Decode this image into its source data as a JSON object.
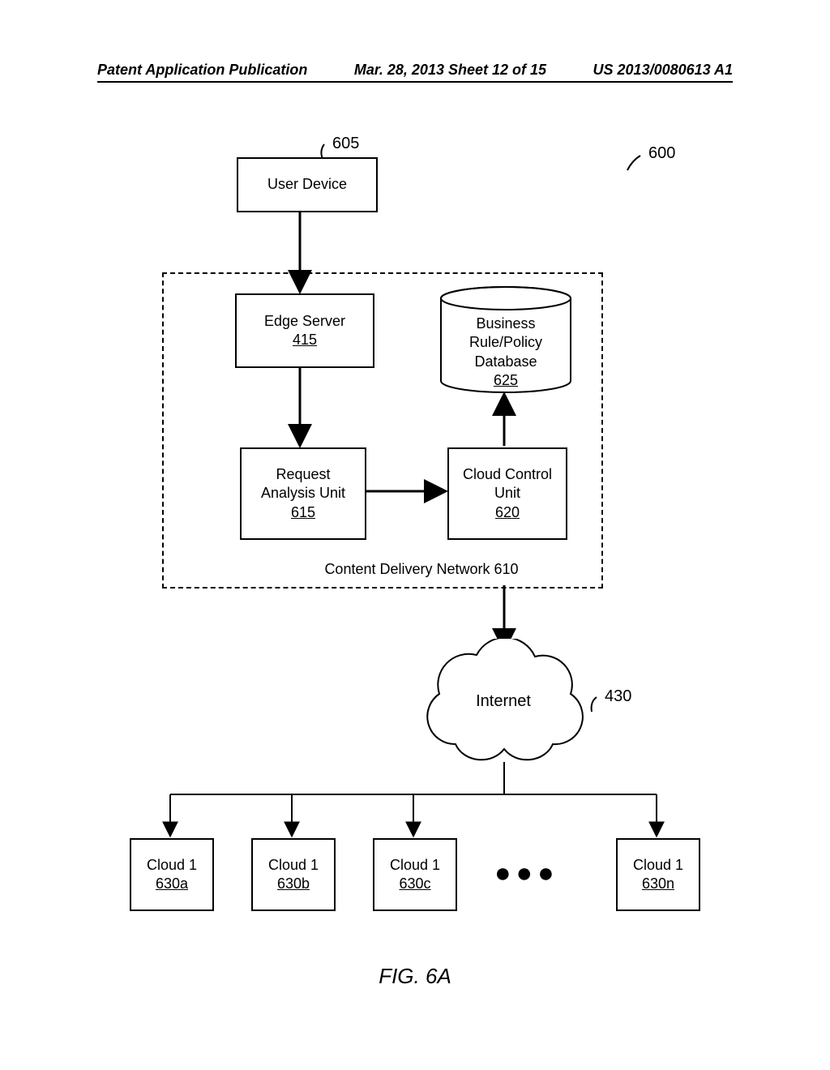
{
  "header": {
    "left": "Patent Application Publication",
    "center": "Mar. 28, 2013  Sheet 12 of 15",
    "right": "US 2013/0080613 A1"
  },
  "figure_label": "FIG. 6A",
  "callouts": {
    "system": "600",
    "user_device": "605",
    "internet": "430"
  },
  "nodes": {
    "user_device": {
      "label": "User Device"
    },
    "edge_server": {
      "label": "Edge Server",
      "ref": "415"
    },
    "request_analysis": {
      "label1": "Request",
      "label2": "Analysis Unit",
      "ref": "615"
    },
    "cloud_control": {
      "label1": "Cloud Control",
      "label2": "Unit",
      "ref": "620"
    },
    "db": {
      "label1": "Business",
      "label2": "Rule/Policy",
      "label3": "Database",
      "ref": "625"
    },
    "cdn_label": "Content Delivery Network 610",
    "internet": "Internet",
    "clouds": [
      {
        "label": "Cloud 1",
        "ref": "630a"
      },
      {
        "label": "Cloud 1",
        "ref": "630b"
      },
      {
        "label": "Cloud 1",
        "ref": "630c"
      },
      {
        "label": "Cloud 1",
        "ref": "630n"
      }
    ]
  }
}
